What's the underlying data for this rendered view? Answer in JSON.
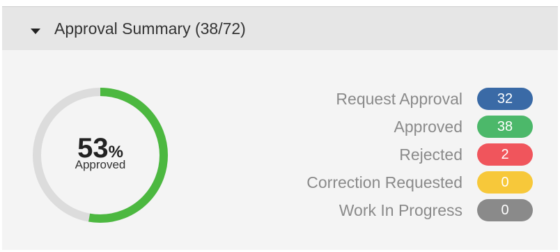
{
  "header": {
    "title": "Approval Summary (38/72)"
  },
  "donut": {
    "percent_value": "53",
    "percent_sign": "%",
    "label": "Approved",
    "fraction": 0.5278,
    "track_color": "#dcdcdc",
    "fill_color": "#4cb840"
  },
  "legend": [
    {
      "label": "Request Approval",
      "count": "32",
      "color": "#3a6aa6"
    },
    {
      "label": "Approved",
      "count": "38",
      "color": "#4cb86a"
    },
    {
      "label": "Rejected",
      "count": "2",
      "color": "#f0555c"
    },
    {
      "label": "Correction Requested",
      "count": "0",
      "color": "#f7c83a"
    },
    {
      "label": "Work In Progress",
      "count": "0",
      "color": "#8a8a8a"
    }
  ]
}
